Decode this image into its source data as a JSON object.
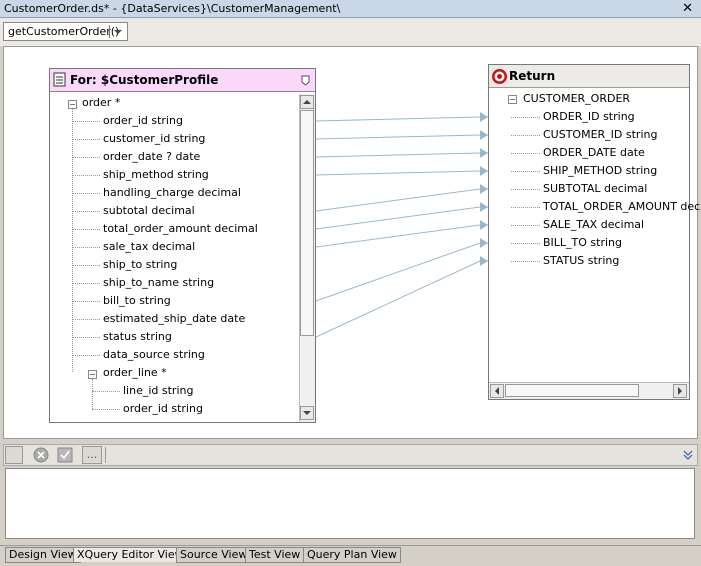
{
  "window": {
    "title": "CustomerOrder.ds* - {DataServices}\\CustomerManagement\\",
    "close": "✕"
  },
  "toolbar": {
    "function_value": "getCustomerOrder()"
  },
  "source": {
    "title": "For: $CustomerProfile",
    "root": "order *",
    "fields": [
      "order_id  string",
      "customer_id  string",
      "order_date ?  date",
      "ship_method  string",
      "handling_charge  decimal",
      "subtotal  decimal",
      "total_order_amount  decimal",
      "sale_tax  decimal",
      "ship_to  string",
      "ship_to_name  string",
      "bill_to  string",
      "estimated_ship_date  date",
      "status  string",
      "data_source  string"
    ],
    "child_group": "order_line *",
    "child_fields": [
      "line_id  string",
      "order_id  string"
    ]
  },
  "return": {
    "title": "Return",
    "root": "CUSTOMER_ORDER",
    "fields": [
      "ORDER_ID  string",
      "CUSTOMER_ID  string",
      "ORDER_DATE  date",
      "SHIP_METHOD  string",
      "SUBTOTAL  decimal",
      "TOTAL_ORDER_AMOUNT  decimal",
      "SALE_TAX  decimal",
      "BILL_TO  string",
      "STATUS  string"
    ]
  },
  "mappings": [
    [
      0,
      0
    ],
    [
      1,
      1
    ],
    [
      2,
      2
    ],
    [
      3,
      3
    ],
    [
      5,
      4
    ],
    [
      6,
      5
    ],
    [
      7,
      6
    ],
    [
      10,
      7
    ],
    [
      12,
      8
    ]
  ],
  "bottom_toolbar": {
    "more_label": "..."
  },
  "tabs": [
    "Design View",
    "XQuery Editor View",
    "Source View",
    "Test View",
    "Query Plan View"
  ],
  "active_tab": 1
}
